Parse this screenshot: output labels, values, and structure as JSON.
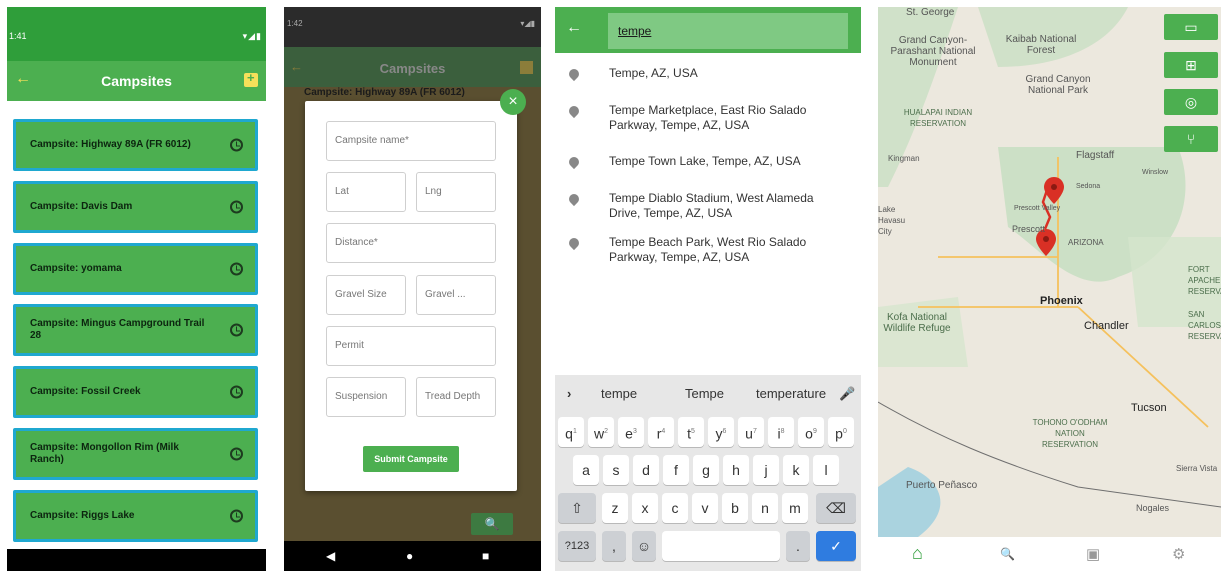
{
  "panel1": {
    "status_time": "1:41",
    "title": "Campsites",
    "cards": [
      "Campsite: Highway 89A (FR 6012)",
      "Campsite: Davis Dam",
      "Campsite: yomama",
      "Campsite: Mingus Campground Trail 28",
      "Campsite: Fossil Creek",
      "Campsite: Mongollon Rim (Milk Ranch)",
      "Campsite: Riggs Lake"
    ]
  },
  "panel2": {
    "status_time": "1:42",
    "title": "Campsites",
    "header_card": "Campsite: Highway 89A (FR 6012)",
    "fields": {
      "name": "Campsite name*",
      "lat": "Lat",
      "lng": "Lng",
      "distance": "Distance*",
      "gravel_size": "Gravel Size",
      "gravel_other": "Gravel ...",
      "permit": "Permit",
      "suspension": "Suspension",
      "tread_depth": "Tread Depth"
    },
    "submit_label": "Submit Campsite"
  },
  "panel3": {
    "query": "tempe",
    "suggestions": [
      "Tempe, AZ, USA",
      "Tempe Marketplace, East Rio Salado Parkway, Tempe, AZ, USA",
      "Tempe Town Lake, Tempe, AZ, USA",
      "Tempe Diablo Stadium, West Alameda Drive, Tempe, AZ, USA",
      "Tempe Beach Park, West Rio Salado Parkway, Tempe, AZ, USA"
    ],
    "kb_suggestions": [
      "tempe",
      "Tempe",
      "temperature"
    ],
    "kb_row1": [
      "q",
      "w",
      "e",
      "r",
      "t",
      "y",
      "u",
      "i",
      "o",
      "p"
    ],
    "kb_row1_hints": [
      "1",
      "2",
      "3",
      "4",
      "5",
      "6",
      "7",
      "8",
      "9",
      "0"
    ],
    "kb_row2": [
      "a",
      "s",
      "d",
      "f",
      "g",
      "h",
      "j",
      "k",
      "l"
    ],
    "kb_row3": [
      "z",
      "x",
      "c",
      "v",
      "b",
      "n",
      "m"
    ],
    "kb_numkey": "?123",
    "kb_comma": ",",
    "kb_period": "."
  },
  "panel4": {
    "labels": [
      "St. George",
      "Grand Canyon-Parashant National Monument",
      "Kaibab National Forest",
      "Grand Canyon National Park",
      "HUALAPAI INDIAN RESERVATION",
      "Kingman",
      "Flagstaff",
      "Sedona",
      "Prescott Valley",
      "Winslow",
      "Prescott",
      "ARIZONA",
      "Phoenix",
      "Chandler",
      "Kofa National Wildlife Refuge",
      "FORT APACHE RESERVATION",
      "SAN CARLOS RESERVATION",
      "Tucson",
      "TOHONO O'ODHAM NATION RESERVATION",
      "Sierra Vista",
      "Puerto Peñasco",
      "Nogales",
      "Lake Havasu City"
    ]
  },
  "colors": {
    "brand_green": "#4caf50",
    "card_border": "#1fa8d0",
    "pin_red": "#d93025"
  },
  "icons": {
    "back": "←",
    "calendar_add": "calendar-plus-icon",
    "clock": "clock-icon",
    "close": "×",
    "search": "🔍",
    "pin": "map-pin-icon",
    "mic": "🎤",
    "backspace": "⌫",
    "shift": "⇧",
    "enter": "✓",
    "emoji": "☺",
    "expand": "›",
    "map_btn": "▭",
    "add_btn": "⊞",
    "locate_btn": "◎",
    "route_btn": "⑂",
    "home": "⌂",
    "profile": "▣",
    "gear": "⚙",
    "nav_back": "◀",
    "nav_home": "●",
    "nav_recent": "■"
  }
}
